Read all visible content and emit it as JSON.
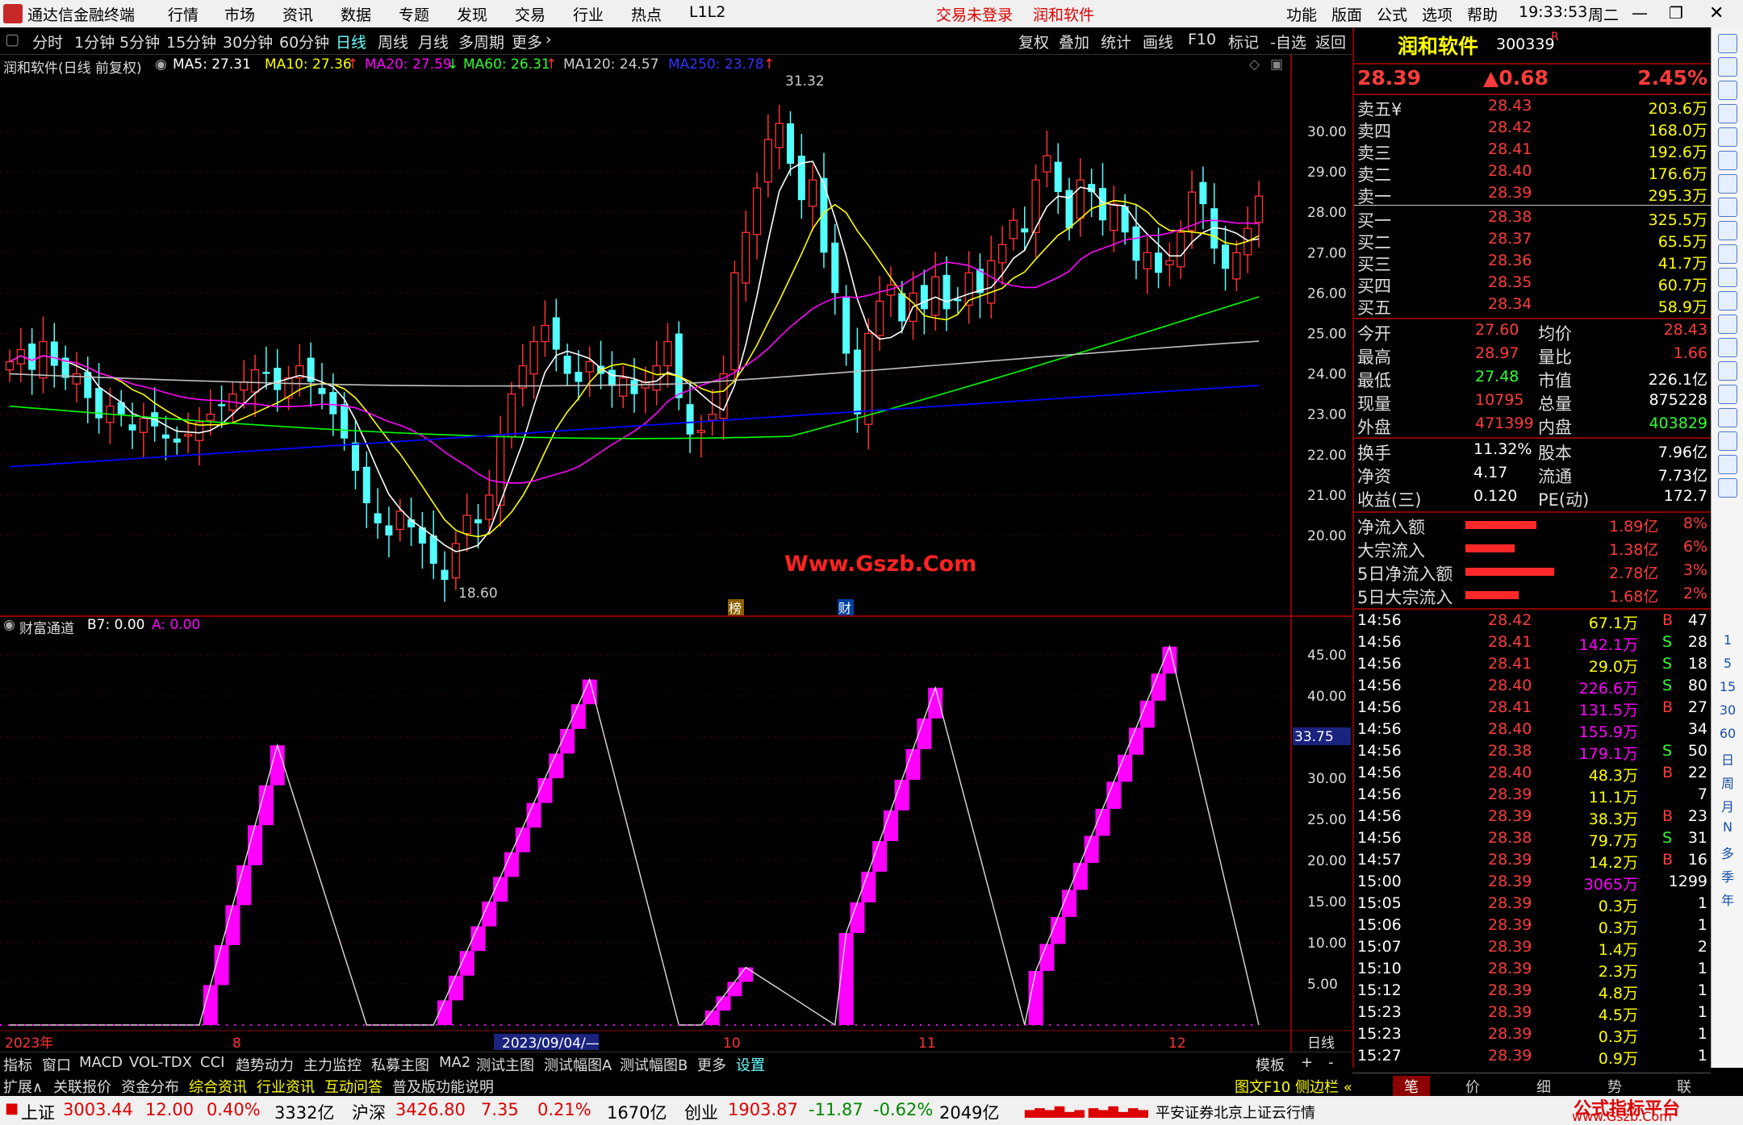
{
  "menubar": {
    "app_name": "通达信金融终端",
    "items": [
      "行情",
      "市场",
      "资讯",
      "数据",
      "专题",
      "发现",
      "交易",
      "行业",
      "热点",
      "L1L2"
    ],
    "login_status": "交易未登录",
    "stock_title": "润和软件",
    "right_items": [
      "功能",
      "版面",
      "公式",
      "选项",
      "帮助"
    ],
    "clock": "19:33:53",
    "weekday": "周二"
  },
  "toolbar": {
    "periods": [
      "分时",
      "1分钟",
      "5分钟",
      "15分钟",
      "30分钟",
      "60分钟",
      "日线",
      "周线",
      "月线",
      "多周期",
      "更多"
    ],
    "active_period": "日线",
    "actions": [
      "复权",
      "叠加",
      "统计",
      "画线",
      "F10",
      "标记",
      "-自选",
      "返回"
    ]
  },
  "ma_line": {
    "title": "润和软件(日线 前复权)",
    "ma5": "MA5: 27.31",
    "ma10": "MA10: 27.36",
    "ma20": "MA20: 27.59",
    "ma60": "MA60: 26.31",
    "ma120": "MA120: 24.57",
    "ma250": "MA250: 23.78",
    "arrow_up": "↑",
    "arrow_down": "↓"
  },
  "price_chart": {
    "high_label": "31.32",
    "low_label": "18.60",
    "watermark": "Www.Gszb.Com",
    "badge_bang": "榜",
    "badge_cai": "财",
    "y_ticks": [
      "30.00",
      "29.00",
      "28.00",
      "27.00",
      "26.00",
      "25.00",
      "24.00",
      "23.00",
      "22.00",
      "21.00",
      "20.00"
    ]
  },
  "indicator": {
    "name": "财富通道",
    "b7": "B7: 0.00",
    "a": "A: 0.00",
    "current": "33.75",
    "y_ticks": [
      "45.00",
      "40.00",
      "35.00",
      "30.00",
      "25.00",
      "20.00",
      "15.00",
      "10.00",
      "5.00"
    ]
  },
  "x_axis": {
    "labels": [
      "2023年",
      "8",
      "2023/09/04/—",
      "10",
      "11",
      "12"
    ],
    "period_label": "日线"
  },
  "quote": {
    "name": "润和软件",
    "code": "300339",
    "r_mark": "R",
    "price": "28.39",
    "change": "▲0.68",
    "change_pct": "2.45%",
    "asks": [
      {
        "label": "卖五¥",
        "price": "28.43",
        "vol": "203.6万"
      },
      {
        "label": "卖四",
        "price": "28.42",
        "vol": "168.0万"
      },
      {
        "label": "卖三",
        "price": "28.41",
        "vol": "192.6万"
      },
      {
        "label": "卖二",
        "price": "28.40",
        "vol": "176.6万"
      },
      {
        "label": "卖一",
        "price": "28.39",
        "vol": "295.3万"
      }
    ],
    "bids": [
      {
        "label": "买一",
        "price": "28.38",
        "vol": "325.5万"
      },
      {
        "label": "买二",
        "price": "28.37",
        "vol": "65.5万"
      },
      {
        "label": "买三",
        "price": "28.36",
        "vol": "41.7万"
      },
      {
        "label": "买四",
        "price": "28.35",
        "vol": "60.7万"
      },
      {
        "label": "买五",
        "price": "28.34",
        "vol": "58.9万"
      }
    ],
    "stats": [
      {
        "l1": "今开",
        "v1": "27.60",
        "l2": "均价",
        "v2": "28.43"
      },
      {
        "l1": "最高",
        "v1": "28.97",
        "l2": "量比",
        "v2": "1.66"
      },
      {
        "l1": "最低",
        "v1": "27.48",
        "l2": "市值",
        "v2": "226.1亿"
      },
      {
        "l1": "现量",
        "v1": "10795",
        "l2": "总量",
        "v2": "875228"
      },
      {
        "l1": "外盘",
        "v1": "471399",
        "l2": "内盘",
        "v2": "403829"
      }
    ],
    "stats2": [
      {
        "l1": "换手",
        "v1": "11.32%",
        "l2": "股本",
        "v2": "7.96亿"
      },
      {
        "l1": "净资",
        "v1": "4.17",
        "l2": "流通",
        "v2": "7.73亿"
      },
      {
        "l1": "收益(三)",
        "v1": "0.120",
        "l2": "PE(动)",
        "v2": "172.7"
      }
    ],
    "flows": [
      {
        "label": "净流入额",
        "value": "1.89亿",
        "pct": "8%",
        "bar": 0.8
      },
      {
        "label": "大宗流入",
        "value": "1.38亿",
        "pct": "6%",
        "bar": 0.55
      },
      {
        "label": "5日净流入额",
        "value": "2.78亿",
        "pct": "3%",
        "bar": 1.0
      },
      {
        "label": "5日大宗流入",
        "value": "1.68亿",
        "pct": "2%",
        "bar": 0.6
      }
    ],
    "ticks": [
      {
        "t": "14:56",
        "p": "28.42",
        "v": "67.1万",
        "bs": "B",
        "n": "47",
        "vc": "yel"
      },
      {
        "t": "14:56",
        "p": "28.41",
        "v": "142.1万",
        "bs": "S",
        "n": "28",
        "vc": "mag"
      },
      {
        "t": "14:56",
        "p": "28.41",
        "v": "29.0万",
        "bs": "S",
        "n": "18",
        "vc": "yel"
      },
      {
        "t": "14:56",
        "p": "28.40",
        "v": "226.6万",
        "bs": "S",
        "n": "80",
        "vc": "mag"
      },
      {
        "t": "14:56",
        "p": "28.41",
        "v": "131.5万",
        "bs": "B",
        "n": "27",
        "vc": "mag"
      },
      {
        "t": "14:56",
        "p": "28.40",
        "v": "155.9万",
        "bs": "",
        "n": "34",
        "vc": "mag"
      },
      {
        "t": "14:56",
        "p": "28.38",
        "v": "179.1万",
        "bs": "S",
        "n": "50",
        "vc": "mag"
      },
      {
        "t": "14:56",
        "p": "28.40",
        "v": "48.3万",
        "bs": "B",
        "n": "22",
        "vc": "yel"
      },
      {
        "t": "14:56",
        "p": "28.39",
        "v": "11.1万",
        "bs": "",
        "n": "7",
        "vc": "yel"
      },
      {
        "t": "14:56",
        "p": "28.39",
        "v": "38.3万",
        "bs": "B",
        "n": "23",
        "vc": "yel"
      },
      {
        "t": "14:56",
        "p": "28.38",
        "v": "79.7万",
        "bs": "S",
        "n": "31",
        "vc": "yel"
      },
      {
        "t": "14:57",
        "p": "28.39",
        "v": "14.2万",
        "bs": "B",
        "n": "16",
        "vc": "yel"
      },
      {
        "t": "15:00",
        "p": "28.39",
        "v": "3065万",
        "bs": "",
        "n": "1299",
        "vc": "mag"
      },
      {
        "t": "15:05",
        "p": "28.39",
        "v": "0.3万",
        "bs": "",
        "n": "1",
        "vc": "yel"
      },
      {
        "t": "15:06",
        "p": "28.39",
        "v": "0.3万",
        "bs": "",
        "n": "1",
        "vc": "yel"
      },
      {
        "t": "15:07",
        "p": "28.39",
        "v": "1.4万",
        "bs": "",
        "n": "2",
        "vc": "yel"
      },
      {
        "t": "15:10",
        "p": "28.39",
        "v": "2.3万",
        "bs": "",
        "n": "1",
        "vc": "yel"
      },
      {
        "t": "15:12",
        "p": "28.39",
        "v": "4.8万",
        "bs": "",
        "n": "1",
        "vc": "yel"
      },
      {
        "t": "15:23",
        "p": "28.39",
        "v": "4.5万",
        "bs": "",
        "n": "1",
        "vc": "yel"
      },
      {
        "t": "15:23",
        "p": "28.39",
        "v": "0.3万",
        "bs": "",
        "n": "1",
        "vc": "yel"
      },
      {
        "t": "15:27",
        "p": "28.39",
        "v": "0.9万",
        "bs": "",
        "n": "1",
        "vc": "yel"
      }
    ],
    "bottom_tabs": [
      "笔",
      "价",
      "细",
      "势",
      "联"
    ]
  },
  "bottom_tabs": [
    "指标",
    "窗口",
    "MACD",
    "VOL-TDX",
    "CCI",
    "趋势动力",
    "主力监控",
    "私募主图",
    "MA2",
    "测试主图",
    "测试幅图A",
    "测试幅图B",
    "更多",
    "设置"
  ],
  "template_tab": "模板",
  "plus": "+",
  "minus": "-",
  "info_tabs": [
    "扩展∧",
    "关联报价",
    "资金分布",
    "综合资讯",
    "行业资讯",
    "互动问答",
    "普及版功能说明"
  ],
  "info_right": "图文F10 侧边栏 «",
  "statusbar": {
    "sh_label": "上证",
    "sh_val": "3003.44",
    "sh_chg": "12.00",
    "sh_pct": "0.40%",
    "sh_amt": "3332亿",
    "sz_label": "沪深",
    "sz_val": "3426.80",
    "sz_chg": "7.35",
    "sz_pct": "0.21%",
    "sz_amt": "1670亿",
    "cy_label": "创业",
    "cy_val": "1903.87",
    "cy_chg": "-11.87",
    "cy_pct": "-0.62%",
    "cy_amt": "2049亿",
    "broker": "平安证券北京上证云行情",
    "watermark": "公式指标平台",
    "watermark2": "www.Gszb.Com"
  },
  "side_icons": [
    "up-arrow-icon",
    "down-arrow-icon",
    "list-icon",
    "table-icon",
    "grid-icon",
    "line-chart-icon",
    "bar-chart-icon",
    "news-icon",
    "f10-icon",
    "doc-icon",
    "doc2-icon",
    "star-icon",
    "gear-icon",
    "f5-icon",
    "target-icon",
    "rsi-icon",
    "move-icon",
    "pen-icon",
    "fs-icon",
    "check-icon"
  ],
  "side_labels": [
    "1",
    "5",
    "15",
    "30",
    "60",
    "日",
    "周",
    "月",
    "N",
    "多",
    "季",
    "年"
  ],
  "chart_data": {
    "type": "candlestick",
    "ma_colors": {
      "ma5": "#ffffff",
      "ma10": "#ffff00",
      "ma20": "#ff00ff",
      "ma60": "#00ff00",
      "ma120": "#c0c0c0",
      "ma250": "#0000ff"
    }
  }
}
